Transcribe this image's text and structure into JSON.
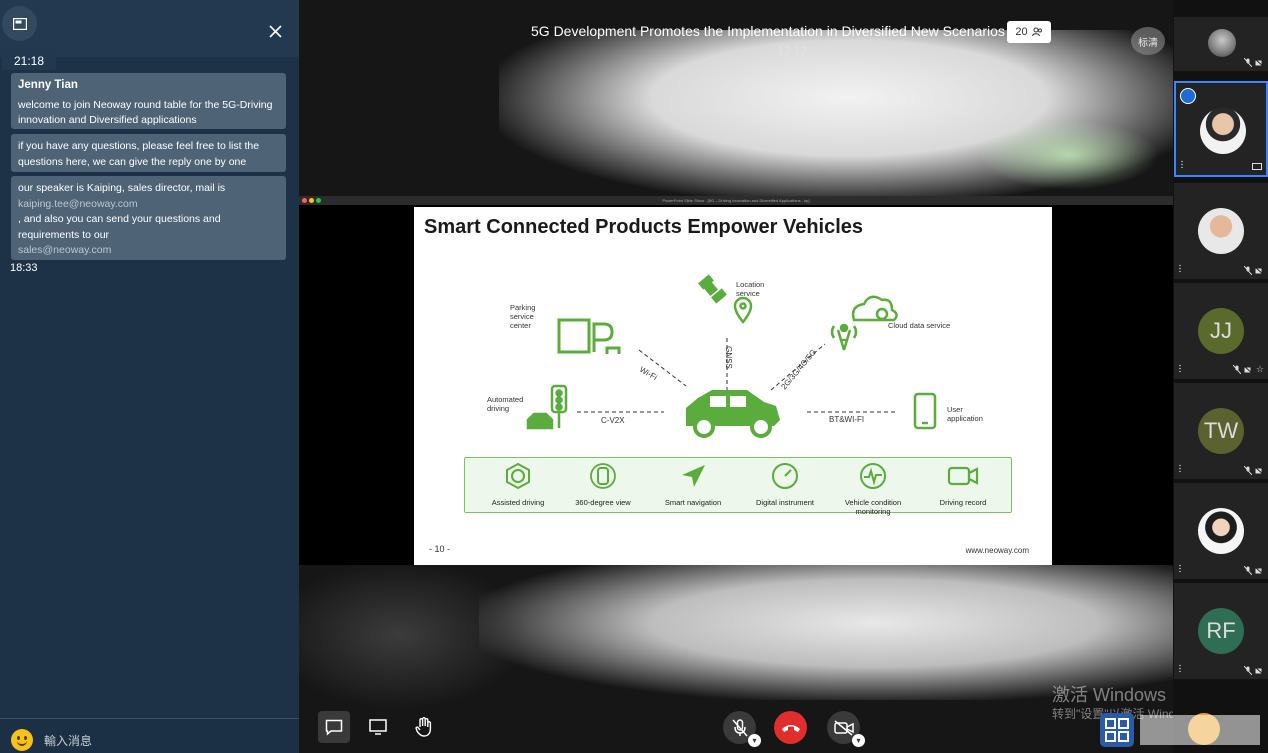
{
  "chat": {
    "time_top": "21:18",
    "messages": [
      {
        "sender": "Jenny Tian",
        "text": "welcome to join Neoway round table for the 5G-Driving innovation and Diversified applications"
      },
      {
        "text": "if you have any questions, please feel free to list the questions here, we can give the reply one by one"
      },
      {
        "text_a": "our speaker is Kaiping, sales director, mail is",
        "mail_a": "kaiping.tee@neoway.com",
        "text_b": ", and also you can send your questions and requirements  to our",
        "mail_b": "sales@neoway.com"
      }
    ],
    "time_bottom": "18:33",
    "input_placeholder": "輸入消息"
  },
  "meeting": {
    "title": "5G Development Promotes the Implementation in Diversified New Scenarios",
    "elapsed": "12:12",
    "participant_count": "20",
    "quality_label": "标清"
  },
  "slide": {
    "window_caption": "PowerPoint Slide Show - [5G – Driving Innovation and Diversified Applications - kp]",
    "title": "Smart Connected Products Empower Vehicles",
    "labels": {
      "parking": "Parking\nservice\ncenter",
      "location": "Location\nservice",
      "cloud": "Cloud data service",
      "automated": "Automated\ndriving",
      "user_app": "User\napplication"
    },
    "connections": {
      "wifi": "Wi-Fi",
      "gnss": "GNSS",
      "cellular": "2G/3G/4G/5G",
      "cv2x": "C-V2X",
      "btwifi": "BT&WI-FI"
    },
    "features": [
      {
        "label": "Assisted driving",
        "icon": "steering-wheel-icon"
      },
      {
        "label": "360-degree view",
        "icon": "car-top-view-icon"
      },
      {
        "label": "Smart navigation",
        "icon": "navigation-arrow-icon"
      },
      {
        "label": "Digital instrument",
        "icon": "gauge-icon"
      },
      {
        "label": "Vehicle condition monitoring",
        "icon": "heartbeat-icon"
      },
      {
        "label": "Driving record",
        "icon": "camera-icon"
      }
    ],
    "page": "- 10 -",
    "website": "www.neoway.com",
    "accent": "#5aac3c"
  },
  "participants": [
    {
      "initials": "",
      "kind": "photo"
    },
    {
      "initials": "",
      "kind": "photo",
      "active": true
    },
    {
      "initials": "",
      "kind": "photo"
    },
    {
      "initials": "JJ",
      "kind": "initials",
      "color": "#5a6a2a"
    },
    {
      "initials": "TW",
      "kind": "initials",
      "color": "#5b6230"
    },
    {
      "initials": "",
      "kind": "photo"
    },
    {
      "initials": "RF",
      "kind": "initials",
      "color": "#2f6d55"
    }
  ],
  "watermark": {
    "line1": "激活 Windows",
    "line2": "转到\"设置\"以激活 Windows。"
  }
}
